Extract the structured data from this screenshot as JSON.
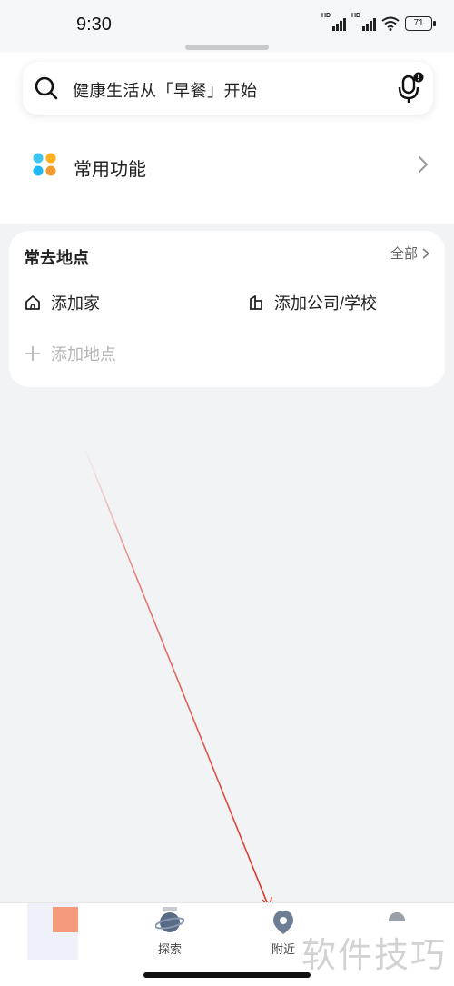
{
  "status_bar": {
    "time": "9:30",
    "signal_1_label": "HD",
    "signal_2_label": "HD",
    "battery": "71"
  },
  "search": {
    "placeholder": "健康生活从「早餐」开始",
    "search_icon": "search-icon",
    "mic_icon": "microphone-icon"
  },
  "functions": {
    "label": "常用功能",
    "icon": "apps-grid-icon",
    "icon_colors": [
      "#3ec6f0",
      "#ffb020",
      "#1fb7f5",
      "#f29a2e"
    ]
  },
  "places": {
    "title": "常去地点",
    "all_label": "全部",
    "home_label": "添加家",
    "work_label": "添加公司/学校",
    "add_label": "添加地点"
  },
  "bottom_nav": {
    "items": [
      {
        "label": "",
        "icon": "home-thumbnail"
      },
      {
        "label": "探索",
        "icon": "planet-icon"
      },
      {
        "label": "附近",
        "icon": "location-pin-icon"
      },
      {
        "label": "",
        "icon": "profile-icon"
      }
    ]
  },
  "watermark": "软件技巧",
  "colors": {
    "annotation_arrow": "#d93025",
    "background": "#f2f3f5"
  }
}
